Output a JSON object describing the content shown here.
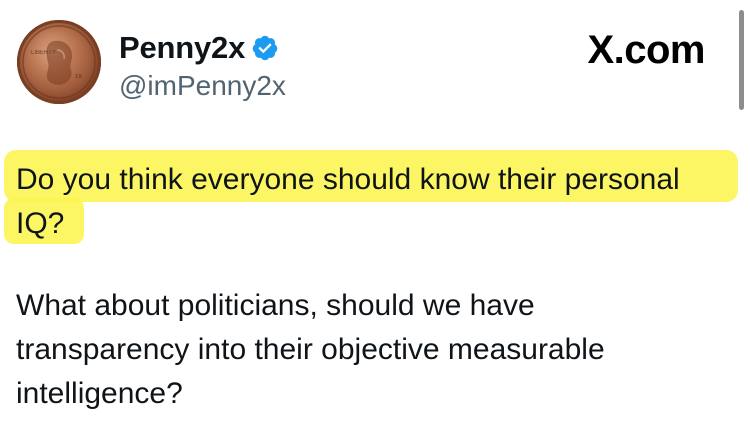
{
  "author": {
    "display_name": "Penny2x",
    "handle": "@imPenny2x",
    "verified": true,
    "avatar": "penny-coin-avatar"
  },
  "brand": {
    "label": "X.com"
  },
  "post": {
    "highlighted_line_1": "Do you think everyone should know their personal",
    "highlighted_line_2": "IQ?",
    "body_line_1": "What about politicians, should we have",
    "body_line_2": "transparency into their objective measurable",
    "body_line_3": "intelligence?"
  },
  "colors": {
    "highlight": "#fbf44a",
    "verified_badge": "#1d9bf0",
    "handle_text": "#536471",
    "primary_text": "#0f1419"
  }
}
